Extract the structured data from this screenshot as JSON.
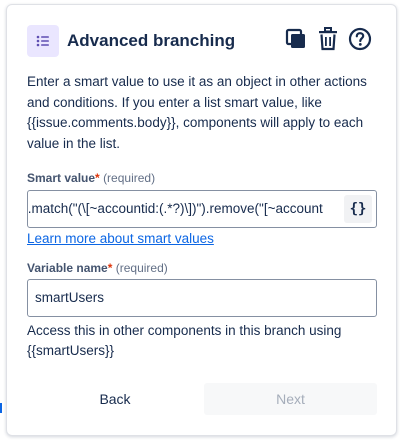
{
  "header": {
    "title": "Advanced branching",
    "icons": {
      "component": "list-branch-icon",
      "copy": "copy-icon",
      "delete": "trash-icon",
      "help": "help-icon"
    }
  },
  "description": "Enter a smart value to use it as an object in other actions and conditions. If you enter a list smart value, like {{issue.comments.body}}, components will apply to each value in the list.",
  "smart_value": {
    "label": "Smart value",
    "required_mark": "*",
    "required_text": "(required)",
    "value": "/.match(\"(\\[~accountid:(.*?)\\])\").remove(\"[~account",
    "brace_button": "{}"
  },
  "learn_link": "Learn more about smart values",
  "variable_name": {
    "label": "Variable name",
    "required_mark": "*",
    "required_text": "(required)",
    "value": "smartUsers"
  },
  "variable_help": "Access this in other components in this branch using {{smartUsers}}",
  "footer": {
    "back": "Back",
    "next": "Next"
  },
  "colors": {
    "accent": "#0c66e4",
    "required": "#de350b",
    "icon_bg": "#eae6ff",
    "icon_fg": "#5e4db2"
  }
}
